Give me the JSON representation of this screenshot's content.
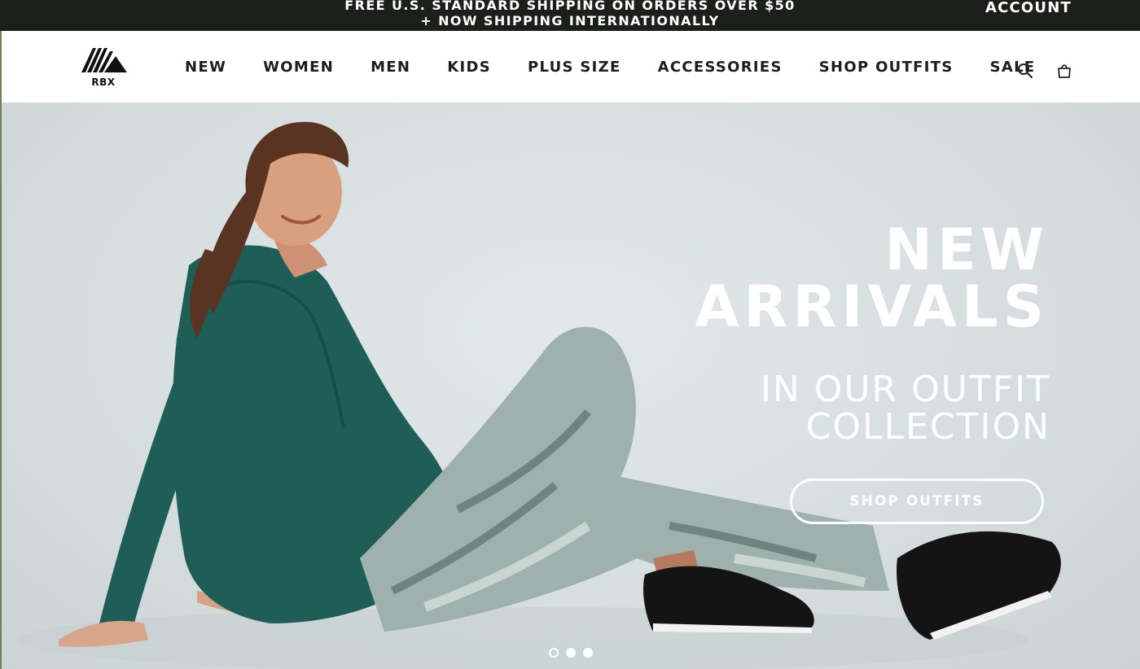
{
  "promo": {
    "line1": "FREE U.S. STANDARD SHIPPING ON ORDERS OVER $50",
    "line2": "+ NOW SHIPPING INTERNATIONALLY",
    "account": "ACCOUNT"
  },
  "header": {
    "logo_text": "RBX",
    "nav": [
      "NEW",
      "WOMEN",
      "MEN",
      "KIDS",
      "PLUS SIZE",
      "ACCESSORIES",
      "SHOP OUTFITS",
      "SALE"
    ],
    "icons": [
      "search-icon",
      "shopping-bag-icon"
    ]
  },
  "hero": {
    "headline_1": "NEW",
    "headline_2": "ARRIVALS",
    "subhead_1": "IN OUR OUTFIT",
    "subhead_2": "COLLECTION",
    "cta": "SHOP OUTFITS",
    "slides": 3,
    "active_slide": 1
  },
  "colors": {
    "promo_bg": "#1d1f1c",
    "hero_bg": "#d6dee0",
    "top_color": "#1f5e57",
    "text_light": "#ffffff"
  }
}
